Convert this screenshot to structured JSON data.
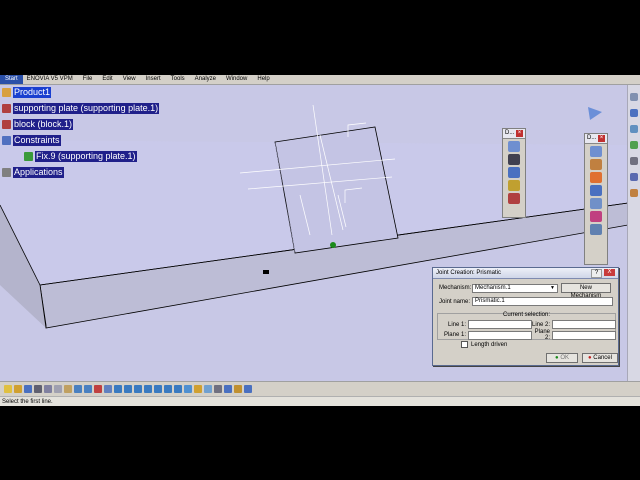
{
  "menubar": {
    "items": [
      "Start",
      "ENOVIA V5 VPM",
      "File",
      "Edit",
      "View",
      "Insert",
      "Tools",
      "Analyze",
      "Window",
      "Help"
    ]
  },
  "tree": {
    "root": "Product1",
    "items": [
      {
        "label": "supporting plate (supporting plate.1)"
      },
      {
        "label": "block (block.1)"
      },
      {
        "label": "Constraints"
      },
      {
        "label": "Fix.9 (supporting plate.1)"
      },
      {
        "label": "Applications"
      }
    ]
  },
  "palettes": {
    "left_title": "D...",
    "right_title": "D..."
  },
  "dialog": {
    "title": "Joint Creation: Prismatic",
    "help": "?",
    "close": "X",
    "mechanism_label": "Mechanism:",
    "mechanism_value": "Mechanism.1",
    "new_mechanism": "New Mechanism",
    "joint_name_label": "Joint name:",
    "joint_name_value": "Prismatic.1",
    "current_selection": "Current selection:",
    "line1_label": "Line 1:",
    "line2_label": "Line 2:",
    "plane1_label": "Plane 1:",
    "plane2_label": "Plane 2:",
    "length_driven": "Length driven",
    "ok": "OK",
    "cancel": "Cancel"
  },
  "status": {
    "text": "Select the first line."
  },
  "colors": {
    "viewport_bg": "#c8c8e6",
    "tree_highlight": "#20208a",
    "dialog_bg": "#d4d0c8"
  }
}
